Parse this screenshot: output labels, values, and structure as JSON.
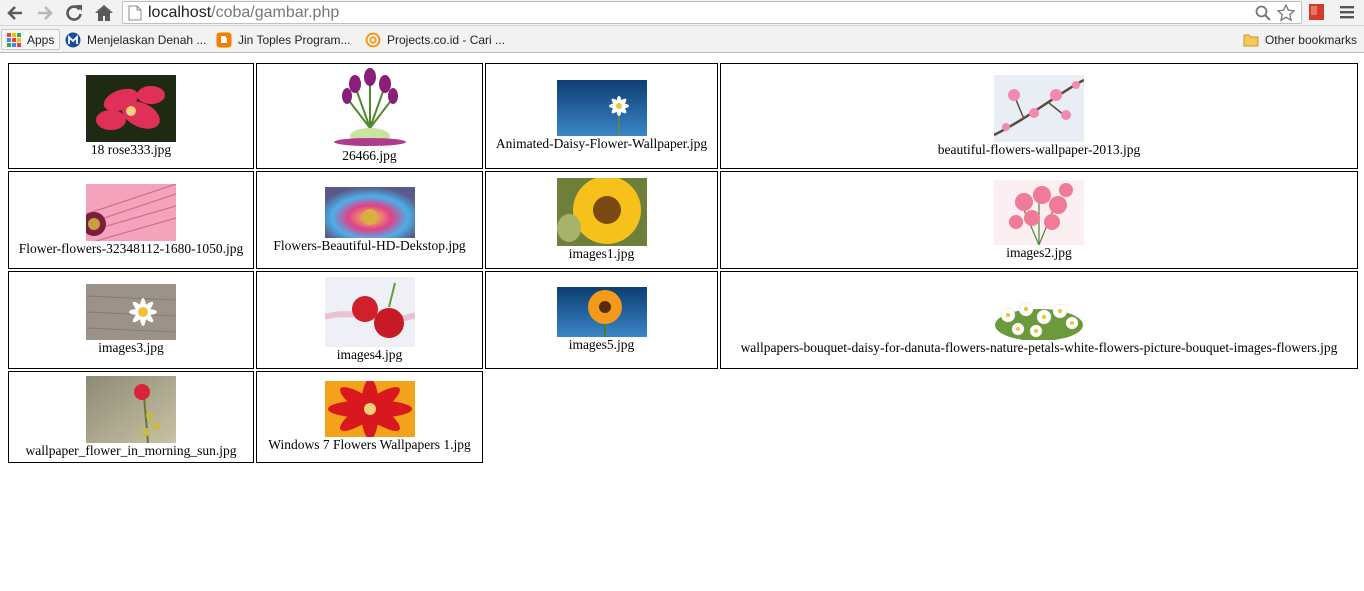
{
  "browser": {
    "url_host": "localhost",
    "url_path": "/coba/gambar.php",
    "bookmarks": [
      {
        "label": "Apps",
        "icon": "apps-grid-icon"
      },
      {
        "label": "Menjelaskan Denah ...",
        "icon": "m-logo-icon"
      },
      {
        "label": "Jin Toples Program...",
        "icon": "blogger-icon"
      },
      {
        "label": "Projects.co.id - Cari ...",
        "icon": "projects-logo-icon"
      }
    ],
    "other_bookmarks": "Other bookmarks"
  },
  "gallery": {
    "rows": [
      [
        {
          "name": "18 rose333.jpg",
          "picture": "red-frangipani"
        },
        {
          "name": "26466.jpg",
          "picture": "purple-tulips"
        },
        {
          "name": "Animated-Daisy-Flower-Wallpaper.jpg",
          "picture": "daisy-blue-sky"
        },
        {
          "name": "beautiful-flowers-wallpaper-2013.jpg",
          "picture": "pink-blossom-branch"
        }
      ],
      [
        {
          "name": "Flower-flowers-32348112-1680-1050.jpg",
          "picture": "pink-gerbera-closeup"
        },
        {
          "name": "Flowers-Beautiful-HD-Dekstop.jpg",
          "picture": "rainbow-gerbera"
        },
        {
          "name": "images1.jpg",
          "picture": "sunflower"
        },
        {
          "name": "images2.jpg",
          "picture": "pink-gerbera-bouquet"
        }
      ],
      [
        {
          "name": "images3.jpg",
          "picture": "white-daisy-wood"
        },
        {
          "name": "images4.jpg",
          "picture": "red-roses"
        },
        {
          "name": "images5.jpg",
          "picture": "orange-gerbera"
        },
        {
          "name": "wallpapers-bouquet-daisy-for-danuta-flowers-nature-petals-white-flowers-picture-bouquet-images-flowers.jpg",
          "picture": "daisy-bouquet"
        }
      ],
      [
        {
          "name": "wallpaper_flower_in_morning_sun.jpg",
          "picture": "red-flower-morning"
        },
        {
          "name": "Windows 7 Flowers Wallpapers 1.jpg",
          "picture": "red-gerbera-drops"
        }
      ]
    ]
  }
}
